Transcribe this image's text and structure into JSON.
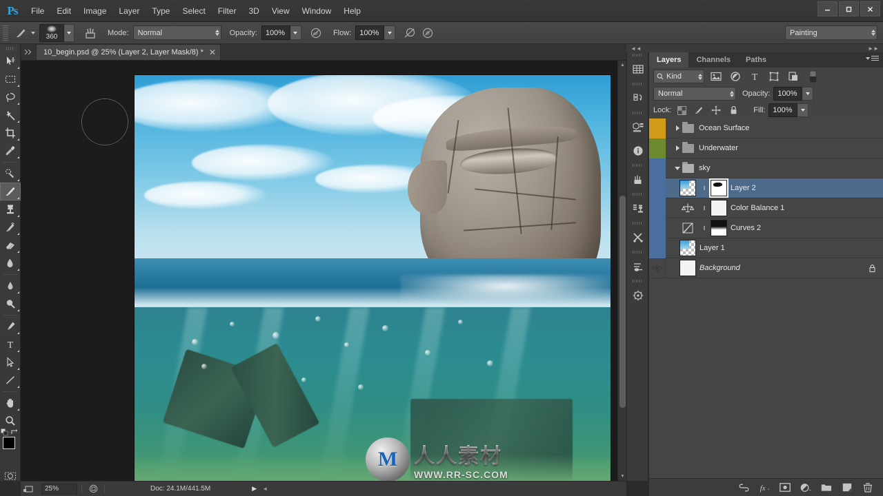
{
  "app": {
    "name": "Ps",
    "title": "Adobe Photoshop"
  },
  "menu": {
    "items": [
      {
        "label": "File"
      },
      {
        "label": "Edit"
      },
      {
        "label": "Image"
      },
      {
        "label": "Layer"
      },
      {
        "label": "Type"
      },
      {
        "label": "Select"
      },
      {
        "label": "Filter"
      },
      {
        "label": "3D"
      },
      {
        "label": "View"
      },
      {
        "label": "Window"
      },
      {
        "label": "Help"
      }
    ]
  },
  "window_controls": {
    "minimize": "—",
    "maximize": "❐",
    "close": "✕"
  },
  "options_bar": {
    "brush_size": "360",
    "mode_label": "Mode:",
    "mode_value": "Normal",
    "opacity_label": "Opacity:",
    "opacity_value": "100%",
    "flow_label": "Flow:",
    "flow_value": "100%",
    "workspace": "Painting"
  },
  "toolbar": {
    "tools": [
      {
        "name": "move-tool",
        "active": false
      },
      {
        "name": "marquee-tool",
        "active": false
      },
      {
        "name": "lasso-tool",
        "active": false
      },
      {
        "name": "magic-wand-tool",
        "active": false
      },
      {
        "name": "crop-tool",
        "active": false
      },
      {
        "name": "eyedropper-tool",
        "active": false
      },
      {
        "name": "healing-brush-tool",
        "active": false
      },
      {
        "name": "brush-tool",
        "active": true
      },
      {
        "name": "clone-stamp-tool",
        "active": false
      },
      {
        "name": "history-brush-tool",
        "active": false
      },
      {
        "name": "eraser-tool",
        "active": false
      },
      {
        "name": "gradient-tool",
        "active": false
      },
      {
        "name": "blur-tool",
        "active": false
      },
      {
        "name": "dodge-tool",
        "active": false
      },
      {
        "name": "pen-tool",
        "active": false
      },
      {
        "name": "type-tool",
        "active": false
      },
      {
        "name": "path-selection-tool",
        "active": false
      },
      {
        "name": "line-tool",
        "active": false
      },
      {
        "name": "hand-tool",
        "active": false
      },
      {
        "name": "zoom-tool",
        "active": false
      }
    ],
    "foreground_color": "#000000",
    "background_color": "#f2f2f2"
  },
  "document": {
    "tab_title": "10_begin.psd @ 25% (Layer 2, Layer Mask/8) *",
    "close_glyph": "✕"
  },
  "status_bar": {
    "zoom": "25%",
    "doc_info": "Doc: 24.1M/441.5M"
  },
  "canvas": {
    "watermark_cn": "人人素材",
    "watermark_url": "WWW.RR-SC.COM",
    "watermark_logo": "M"
  },
  "layers_panel": {
    "tabs": [
      {
        "label": "Layers",
        "active": true
      },
      {
        "label": "Channels",
        "active": false
      },
      {
        "label": "Paths",
        "active": false
      }
    ],
    "filter_kind": "Kind",
    "blend_mode": "Normal",
    "opacity_label": "Opacity:",
    "opacity_value": "100%",
    "lock_label": "Lock:",
    "fill_label": "Fill:",
    "fill_value": "100%",
    "layers": [
      {
        "name": "Ocean Surface",
        "type": "group",
        "expanded": false,
        "visible": true,
        "selected": false,
        "strip_color": "#d39b1a",
        "locked": false
      },
      {
        "name": "Underwater",
        "type": "group",
        "expanded": false,
        "visible": true,
        "selected": false,
        "strip_color": "#6d8a2e",
        "locked": false
      },
      {
        "name": "sky",
        "type": "group",
        "expanded": true,
        "visible": true,
        "selected": false,
        "strip_color": "#4a6f9e",
        "locked": false
      },
      {
        "name": "Layer 2",
        "type": "pixel-with-mask",
        "visible": true,
        "selected": true,
        "strip_color": "#4a6f9e",
        "locked": false
      },
      {
        "name": "Color Balance 1",
        "type": "adjustment-color-balance",
        "visible": true,
        "selected": false,
        "strip_color": "#4a6f9e",
        "locked": false
      },
      {
        "name": "Curves 2",
        "type": "adjustment-curves",
        "visible": true,
        "selected": false,
        "strip_color": "#4a6f9e",
        "locked": false
      },
      {
        "name": "Layer 1",
        "type": "pixel",
        "visible": true,
        "selected": false,
        "strip_color": "#4a6f9e",
        "locked": false
      },
      {
        "name": "Background",
        "type": "background",
        "visible": true,
        "selected": false,
        "italic": true,
        "strip_color": "transparent",
        "locked": true
      }
    ],
    "footer_icons": [
      "link-layers-icon",
      "layer-style-fx-icon",
      "add-layer-mask-icon",
      "new-adjustment-layer-icon",
      "new-group-icon",
      "new-layer-icon",
      "delete-layer-icon"
    ]
  },
  "mini_dock": {
    "items": [
      "mini-bridge-icon",
      "history-icon",
      "properties-icon",
      "info-icon",
      "brush-presets-icon",
      "clone-source-icon",
      "tool-presets-icon",
      "adjustments-icon",
      "navigator-icon"
    ]
  },
  "colors": {
    "accent": "#2fa8e0",
    "selection": "#4e6a8a",
    "panel_bg": "#3c3c3c",
    "list_bg": "#454545"
  }
}
